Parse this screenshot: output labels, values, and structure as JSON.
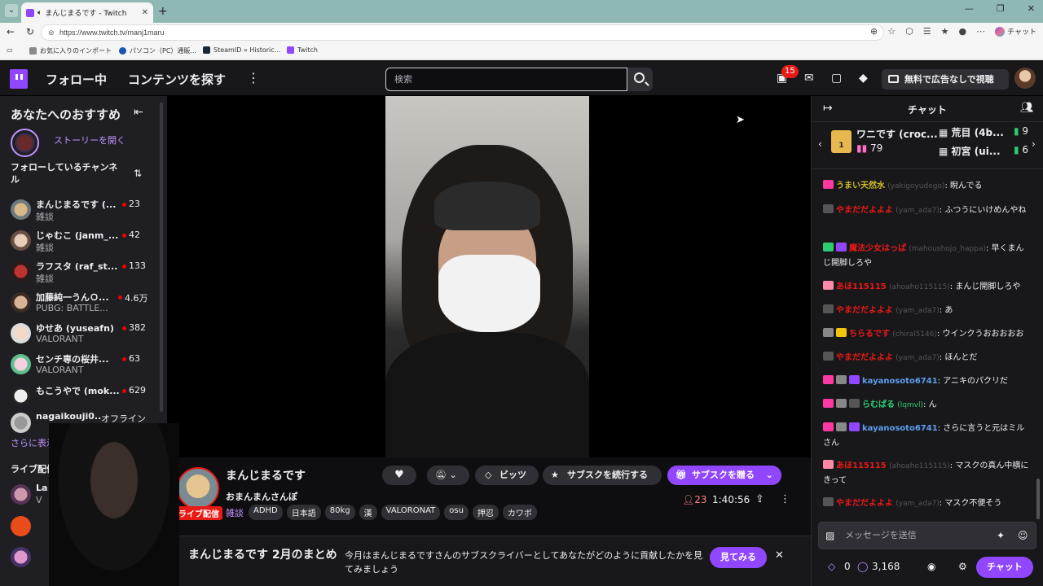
{
  "browser": {
    "tab_title": "まんじまるです - Twitch",
    "tab_close": "✕",
    "new_tab": "+",
    "url": "https://www.twitch.tv/manj1maru",
    "copilot_label": "チャット",
    "bookmarks": [
      "お気に入りのインポート",
      "パソコン（PC）通販...",
      "SteamID » Historic...",
      "Twitch"
    ]
  },
  "nav": {
    "following": "フォロー中",
    "browse": "コンテンツを探す",
    "search_placeholder": "検索",
    "notifications_count": "15",
    "ad_free_label": "無料で広告なしで視聴"
  },
  "sidebar": {
    "recommended_title": "あなたへのおすすめ",
    "story_label": "ストーリーを開く",
    "followed_title": "フォローしているチャンネル",
    "channels": [
      {
        "name": "まんじまるです (...",
        "game": "雑談",
        "viewers": "23"
      },
      {
        "name": "じゃむこ (janm_...",
        "game": "雑談",
        "viewers": "42"
      },
      {
        "name": "ラフスタ (raf_st...",
        "game": "雑談",
        "viewers": "133"
      },
      {
        "name": "加藤純一うんＯ...",
        "game": "PUBG: BATTLE...",
        "viewers": "4.6万"
      },
      {
        "name": "ゆせあ (yuseafn)",
        "game": "VALORANT",
        "viewers": "382"
      },
      {
        "name": "センチ専の桜井...",
        "game": "VALORANT",
        "viewers": "63"
      },
      {
        "name": "もこうやで (mok...",
        "game": "",
        "viewers": "629"
      },
      {
        "name": "nagaikouji0...",
        "game": "",
        "status": "オフライン"
      }
    ],
    "show_more": "さらに表示",
    "live_title": "ライブ配信",
    "live_partial": {
      "name": "La",
      "game": "V"
    }
  },
  "stream": {
    "streamer_name": "まんじまるです",
    "title": "おまんまんさんぽ",
    "live_badge": "ライブ配信",
    "category": "雑談",
    "tags": [
      "ADHD",
      "日本語",
      "80kg",
      "漢",
      "VALORONAT",
      "osu",
      "押忍",
      "カワボ"
    ],
    "bits_label": "ビッツ",
    "sub_continue_label": "サブスクを続行する",
    "gift_label": "サブスクを贈る",
    "viewer_count": "23",
    "uptime": "1:40:56"
  },
  "banner": {
    "title": "まんじまるです 2月のまとめ",
    "text": "今月はまんじまるですさんのサブスクライバーとしてあなたがどのように貢献したかを見てみましょう",
    "watch_label": "見てみる"
  },
  "chat": {
    "title": "チャット",
    "leaderboard": {
      "top_name": "ワニです (croc...",
      "top_count": "79",
      "top_rank": "1",
      "side": [
        {
          "name": "荒目 (4b...",
          "count": "9"
        },
        {
          "name": "初宮 (ui...",
          "count": "6"
        }
      ]
    },
    "messages": [
      {
        "user": "うまい天然水",
        "id": "(yakigoyudego)",
        "text": ": 睨んでる",
        "color": "#d3bd2c"
      },
      {
        "user": "やまだだよよよ",
        "id": "(yam_ada7)",
        "text": ": ふつうにいけめんやね",
        "color": "#e91916"
      },
      {
        "user": "魔法少女はっぱ",
        "id": "(mahoushojo_happa)",
        "text": ": 早くまんじ開脚しろや",
        "color": "#e91916"
      },
      {
        "user": "あほ115115",
        "id": "(ahoaho115115)",
        "text": ": まんじ開脚しろや",
        "color": "#e91916"
      },
      {
        "user": "やまだだよよよ",
        "id": "(yam_ada7)",
        "text": ": あ",
        "color": "#e91916"
      },
      {
        "user": "ちらるです",
        "id": "(chiral5146)",
        "text": ": ウインクうおおおおお",
        "color": "#e91916"
      },
      {
        "user": "やまだだよよよ",
        "id": "(yam_ada7)",
        "text": ": ほんとだ",
        "color": "#e91916"
      },
      {
        "user": "kayanosoto6741",
        "id": "",
        "text": ": アニキのパクリだ",
        "color": "#5e9ef0"
      },
      {
        "user": "らむぱる",
        "id": "(lqmvl)",
        "text": ": ん",
        "color": "#2ecc71"
      },
      {
        "user": "kayanosoto6741",
        "id": "",
        "text": ": さらに言うと元はミルさん",
        "color": "#5e9ef0"
      },
      {
        "user": "あほ115115",
        "id": "(ahoaho115115)",
        "text": ": マスクの真ん中横にきって",
        "color": "#e91916"
      },
      {
        "user": "やまだだよよよ",
        "id": "(yam_ada7)",
        "text": ": マスク不便そう",
        "color": "#e91916"
      }
    ],
    "input_placeholder": "メッセージを送信",
    "bits_count": "0",
    "points_count": "3,168",
    "send_label": "チャット"
  }
}
